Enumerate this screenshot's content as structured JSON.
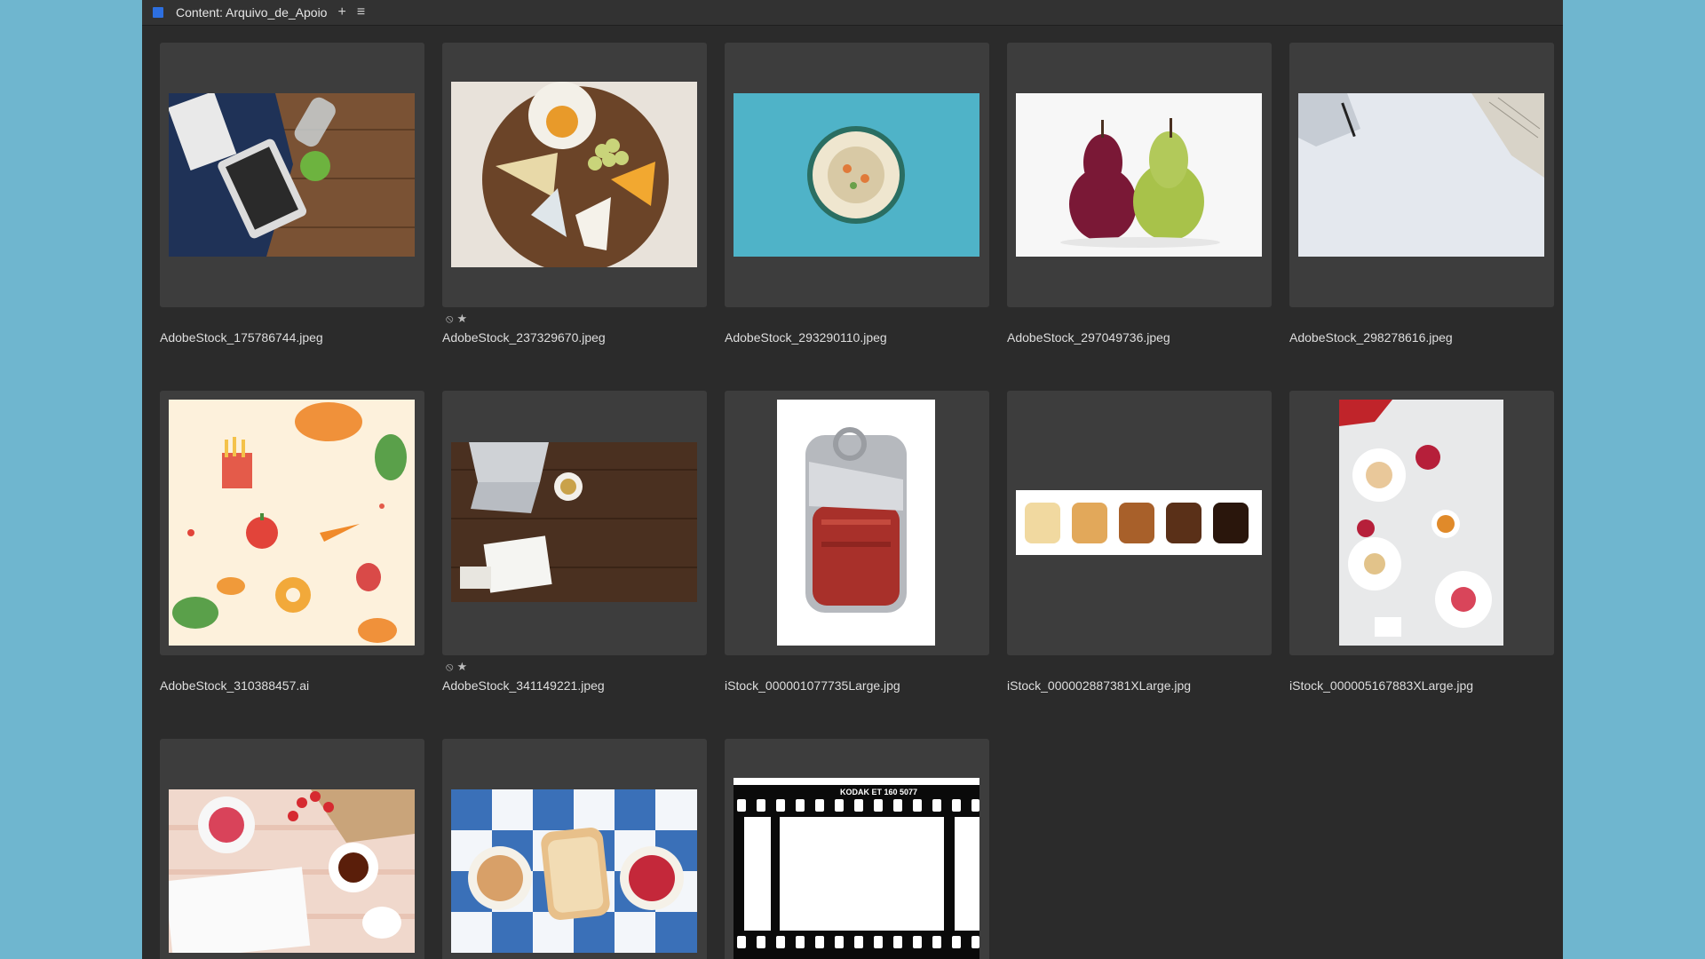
{
  "window": {
    "tab_title": "Content: Arquivo_de_Apoio",
    "add_icon": "plus-icon",
    "menu_icon": "hamburger-menu-icon",
    "accent_color": "#2d6fe0"
  },
  "items": [
    {
      "filename": "AdobeStock_175786744.jpeg"
    },
    {
      "filename": "AdobeStock_237329670.jpeg",
      "badges": [
        "reject",
        "star"
      ]
    },
    {
      "filename": "AdobeStock_293290110.jpeg"
    },
    {
      "filename": "AdobeStock_297049736.jpeg"
    },
    {
      "filename": "AdobeStock_298278616.jpeg"
    },
    {
      "filename": "AdobeStock_310388457.ai"
    },
    {
      "filename": "AdobeStock_341149221.jpeg",
      "badges": [
        "reject",
        "star"
      ]
    },
    {
      "filename": "iStock_000001077735Large.jpg"
    },
    {
      "filename": "iStock_000002887381XLarge.jpg"
    },
    {
      "filename": "iStock_000005167883XLarge.jpg"
    },
    {
      "filename": ""
    },
    {
      "filename": ""
    },
    {
      "filename": "",
      "film_text": "KODAK ET 160 5077"
    }
  ],
  "badge_glyphs": {
    "reject": "⦸",
    "star": "★"
  }
}
